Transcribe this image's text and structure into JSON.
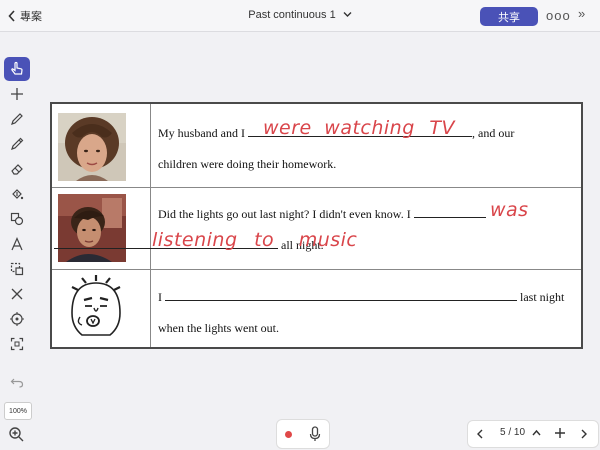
{
  "topbar": {
    "back_label": "專案",
    "title": "Past continuous 1",
    "share_label": "共享",
    "more_label": "ooo",
    "collapse_label": "»"
  },
  "toolbar": {
    "zoom_level": "100%",
    "tools": [
      "hand-pointer",
      "add",
      "pen",
      "highlighter",
      "eraser",
      "fill",
      "shapes",
      "text",
      "lasso",
      "close",
      "target",
      "crop",
      "undo"
    ]
  },
  "worksheet": {
    "rows": [
      {
        "line1_start": "My husband and I",
        "line1_end": ", and our",
        "line2": "children were doing their homework.",
        "handwriting": [
          "were",
          "watching",
          "TV"
        ]
      },
      {
        "line1_start": "Did the lights go out last night?   I didn't even know.   I",
        "line2_end": "all night.",
        "handwriting": [
          "was",
          "listening",
          "to",
          "music"
        ]
      },
      {
        "line1_start": "I",
        "line1_end": "last night",
        "line2": "when the lights went out."
      }
    ]
  },
  "bottom": {
    "page_indicator": "5 / 10",
    "record_dots": "...",
    "accent_color": "#4a52b7",
    "ink_color": "#d9454a"
  }
}
